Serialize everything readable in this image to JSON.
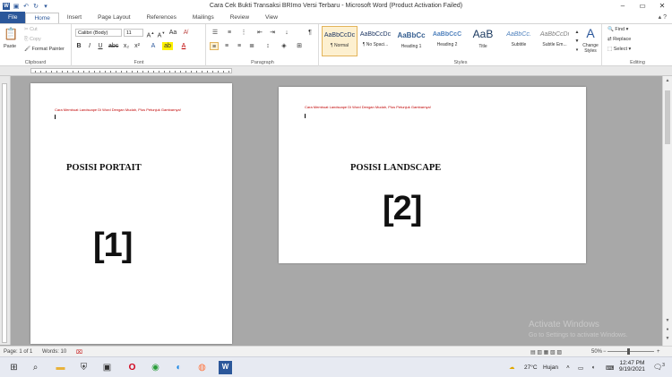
{
  "window": {
    "title": "Cara Cek Bukti Transaksi BRImo Versi Terbaru  -  Microsoft Word (Product Activation Failed)",
    "minimize": "–",
    "maximize": "▭",
    "close": "✕"
  },
  "tabs": [
    "File",
    "Home",
    "Insert",
    "Page Layout",
    "References",
    "Mailings",
    "Review",
    "View"
  ],
  "clipboard": {
    "paste": "Paste",
    "cut": "Cut",
    "copy": "Copy",
    "format_painter": "Format Painter",
    "label": "Clipboard"
  },
  "font": {
    "name": "Calibri (Body)",
    "size": "11",
    "label": "Font",
    "bold": "B",
    "italic": "I",
    "underline": "U"
  },
  "paragraph": {
    "label": "Paragraph",
    "pilcrow": "¶"
  },
  "styles": {
    "label": "Styles",
    "items": [
      {
        "preview": "AaBbCcDc",
        "name": "¶ Normal"
      },
      {
        "preview": "AaBbCcDc",
        "name": "¶ No Spaci..."
      },
      {
        "preview": "AaBbCc",
        "name": "Heading 1"
      },
      {
        "preview": "AaBbCcC",
        "name": "Heading 2"
      },
      {
        "preview": "AaB",
        "name": "Title"
      },
      {
        "preview": "AaBbCc.",
        "name": "Subtitle"
      },
      {
        "preview": "AaBbCcDi",
        "name": "Subtle Em..."
      }
    ],
    "change_styles": "Change Styles"
  },
  "editing": {
    "find": "Find",
    "replace": "Replace",
    "select": "Select",
    "label": "Editing"
  },
  "page1": {
    "header": "Cara Membuat Landscape Di Word Dengan Mudah, Plus Petunjuk Gambarnya!",
    "title": "POSISI PORTAIT",
    "number": "[1]"
  },
  "page2": {
    "header": "Cara Membuat Landscape Di Word Dengan Mudah, Plus Petunjuk Gambarnya!",
    "title": "POSISI LANDSCAPE",
    "number": "[2]"
  },
  "watermark": {
    "line1": "Activate Windows",
    "line2": "Go to Settings to activate Windows."
  },
  "status": {
    "page": "Page: 1 of 1",
    "words": "Words: 10",
    "zoom": "50%"
  },
  "taskbar": {
    "temperature": "27°C",
    "weather": "Hujan",
    "time": "12:47 PM",
    "date": "9/19/2021",
    "notifications": "3"
  }
}
